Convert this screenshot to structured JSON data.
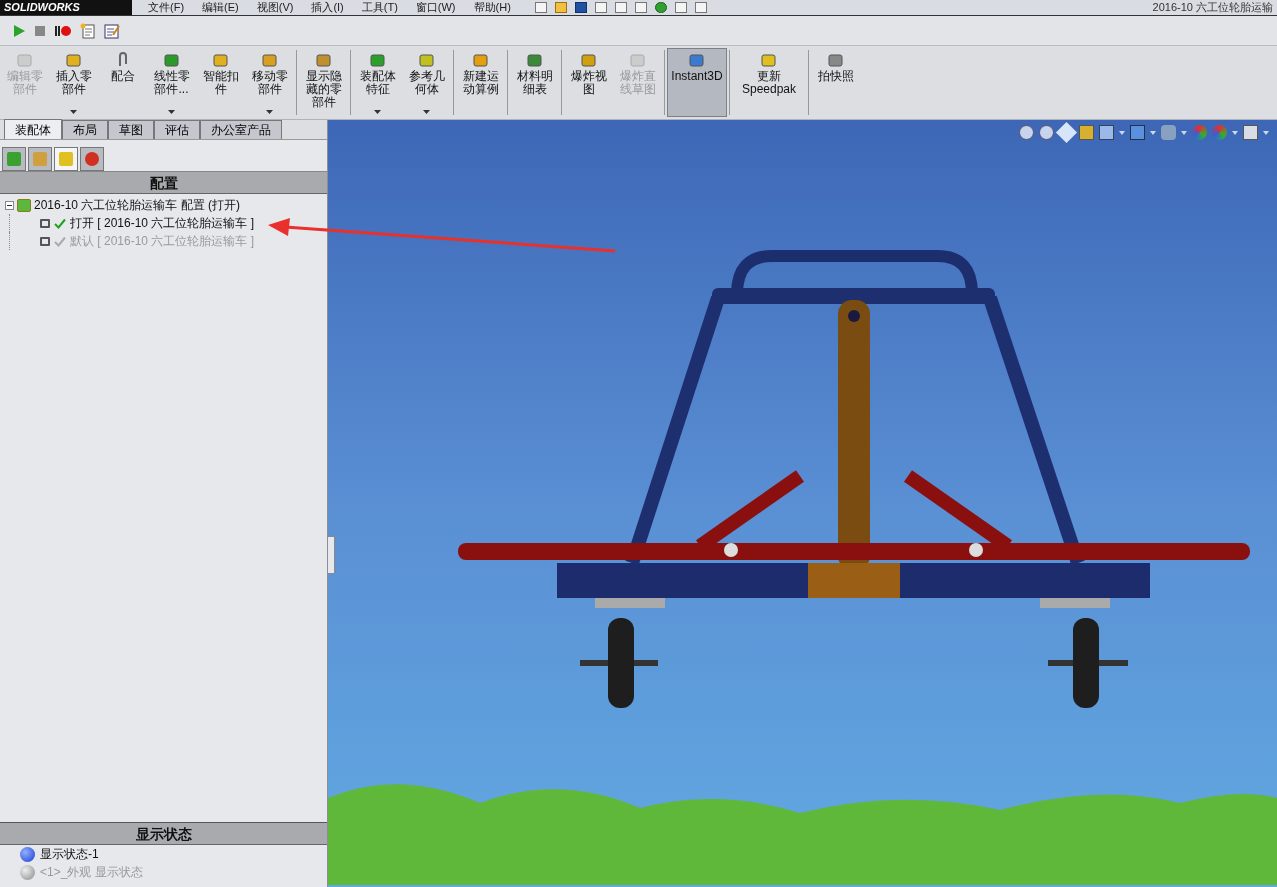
{
  "menu": {
    "logo": "SOLIDWORKS",
    "items": [
      "文件(F)",
      "编辑(E)",
      "视图(V)",
      "插入(I)",
      "工具(T)",
      "窗口(W)",
      "帮助(H)"
    ],
    "title": "2016-10 六工位轮胎运输"
  },
  "command_manager": {
    "groups": [
      [
        {
          "kind": "edit",
          "label": "编辑零部件",
          "disabled": true,
          "dropdown": false,
          "selected": false
        },
        {
          "kind": "insert",
          "label": "插入零部件",
          "disabled": false,
          "dropdown": true,
          "selected": false
        },
        {
          "kind": "mate",
          "label": "配合",
          "disabled": false,
          "dropdown": false,
          "selected": false
        },
        {
          "kind": "pattern",
          "label": "线性零部件...",
          "disabled": false,
          "dropdown": true,
          "selected": false
        },
        {
          "kind": "fastener",
          "label": "智能扣件",
          "disabled": false,
          "dropdown": false,
          "selected": false
        },
        {
          "kind": "move",
          "label": "移动零部件",
          "disabled": false,
          "dropdown": true,
          "selected": false
        }
      ],
      [
        {
          "kind": "show",
          "label": "显示隐藏的零部件",
          "disabled": false,
          "dropdown": false,
          "selected": false
        }
      ],
      [
        {
          "kind": "feature",
          "label": "装配体特征",
          "disabled": false,
          "dropdown": true,
          "selected": false
        },
        {
          "kind": "refgeom",
          "label": "参考几何体",
          "disabled": false,
          "dropdown": true,
          "selected": false
        }
      ],
      [
        {
          "kind": "motion",
          "label": "新建运动算例",
          "disabled": false,
          "dropdown": false,
          "selected": false
        }
      ],
      [
        {
          "kind": "bom",
          "label": "材料明细表",
          "disabled": false,
          "dropdown": false,
          "selected": false
        }
      ],
      [
        {
          "kind": "explode",
          "label": "爆炸视图",
          "disabled": false,
          "dropdown": false,
          "selected": false
        },
        {
          "kind": "explodeline",
          "label": "爆炸直线草图",
          "disabled": true,
          "dropdown": false,
          "selected": false
        }
      ],
      [
        {
          "kind": "instant3d",
          "label": "Instant3D",
          "disabled": false,
          "dropdown": false,
          "selected": true
        }
      ],
      [
        {
          "kind": "speedpak",
          "label": "更新 Speedpak",
          "disabled": false,
          "dropdown": false,
          "selected": false
        }
      ],
      [
        {
          "kind": "snapshot",
          "label": "拍快照",
          "disabled": false,
          "dropdown": false,
          "selected": false
        }
      ]
    ]
  },
  "tabs": [
    {
      "label": "装配体",
      "selected": true
    },
    {
      "label": "布局",
      "selected": false
    },
    {
      "label": "草图",
      "selected": false
    },
    {
      "label": "评估",
      "selected": false
    },
    {
      "label": "办公室产品",
      "selected": false
    }
  ],
  "panel_icons": [
    {
      "kind": "feature",
      "selected": false
    },
    {
      "kind": "property",
      "selected": false
    },
    {
      "kind": "config",
      "selected": true
    },
    {
      "kind": "display",
      "selected": false
    }
  ],
  "configurations": {
    "header": "配置",
    "root": {
      "label": "2016-10 六工位轮胎运输车 配置  (打开)",
      "children": [
        {
          "label": "打开 [ 2016-10 六工位轮胎运输车 ]",
          "active": true
        },
        {
          "label": "默认 [ 2016-10 六工位轮胎运输车 ]",
          "active": false
        }
      ]
    }
  },
  "display_states": {
    "header": "显示状态",
    "items": [
      {
        "label": "显示状态-1",
        "active": true
      },
      {
        "label": "<1>_外观 显示状态",
        "active": false
      }
    ]
  }
}
